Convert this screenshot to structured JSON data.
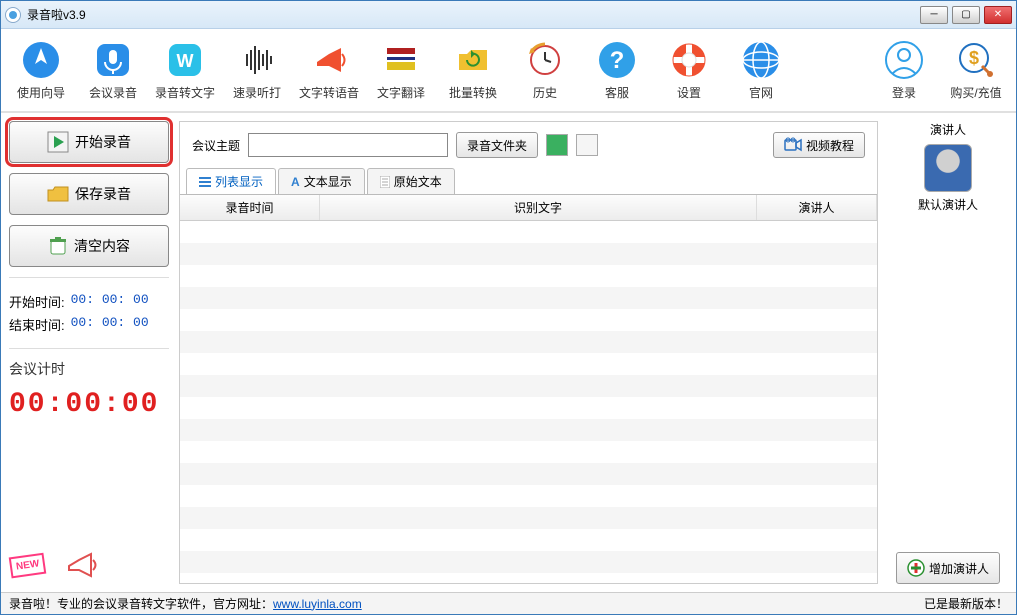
{
  "window": {
    "title": "录音啦v3.9"
  },
  "toolbar": [
    {
      "name": "guide",
      "label": "使用向导"
    },
    {
      "name": "meeting",
      "label": "会议录音"
    },
    {
      "name": "rec2txt",
      "label": "录音转文字"
    },
    {
      "name": "listen",
      "label": "速录听打"
    },
    {
      "name": "txt2sp",
      "label": "文字转语音"
    },
    {
      "name": "translate",
      "label": "文字翻译"
    },
    {
      "name": "batch",
      "label": "批量转换"
    },
    {
      "name": "history",
      "label": "历史"
    },
    {
      "name": "service",
      "label": "客服"
    },
    {
      "name": "settings",
      "label": "设置"
    },
    {
      "name": "website",
      "label": "官网"
    },
    {
      "name": "login",
      "label": "登录"
    },
    {
      "name": "buy",
      "label": "购买/充值"
    }
  ],
  "left": {
    "start": "开始录音",
    "save": "保存录音",
    "clear": "清空内容",
    "start_time_label": "开始时间:",
    "start_time_value": "00: 00: 00",
    "end_time_label": "结束时间:",
    "end_time_value": "00: 00: 00",
    "timer_label": "会议计时",
    "timer_value": "00:00:00",
    "new_badge": "NEW"
  },
  "center": {
    "topic_label": "会议主题",
    "topic_value": "",
    "folder_btn": "录音文件夹",
    "tutorial_btn": "视频教程",
    "tabs": {
      "list": "列表显示",
      "text": "文本显示",
      "raw": "原始文本"
    },
    "columns": {
      "time": "录音时间",
      "text": "识别文字",
      "speaker": "演讲人"
    }
  },
  "right": {
    "title": "演讲人",
    "default_speaker": "默认演讲人",
    "add_speaker": "增加演讲人"
  },
  "status": {
    "left_prefix": "录音啦！专业的会议录音转文字软件，官方网址：",
    "url": "www.luyinla.com",
    "right": "已是最新版本！"
  }
}
